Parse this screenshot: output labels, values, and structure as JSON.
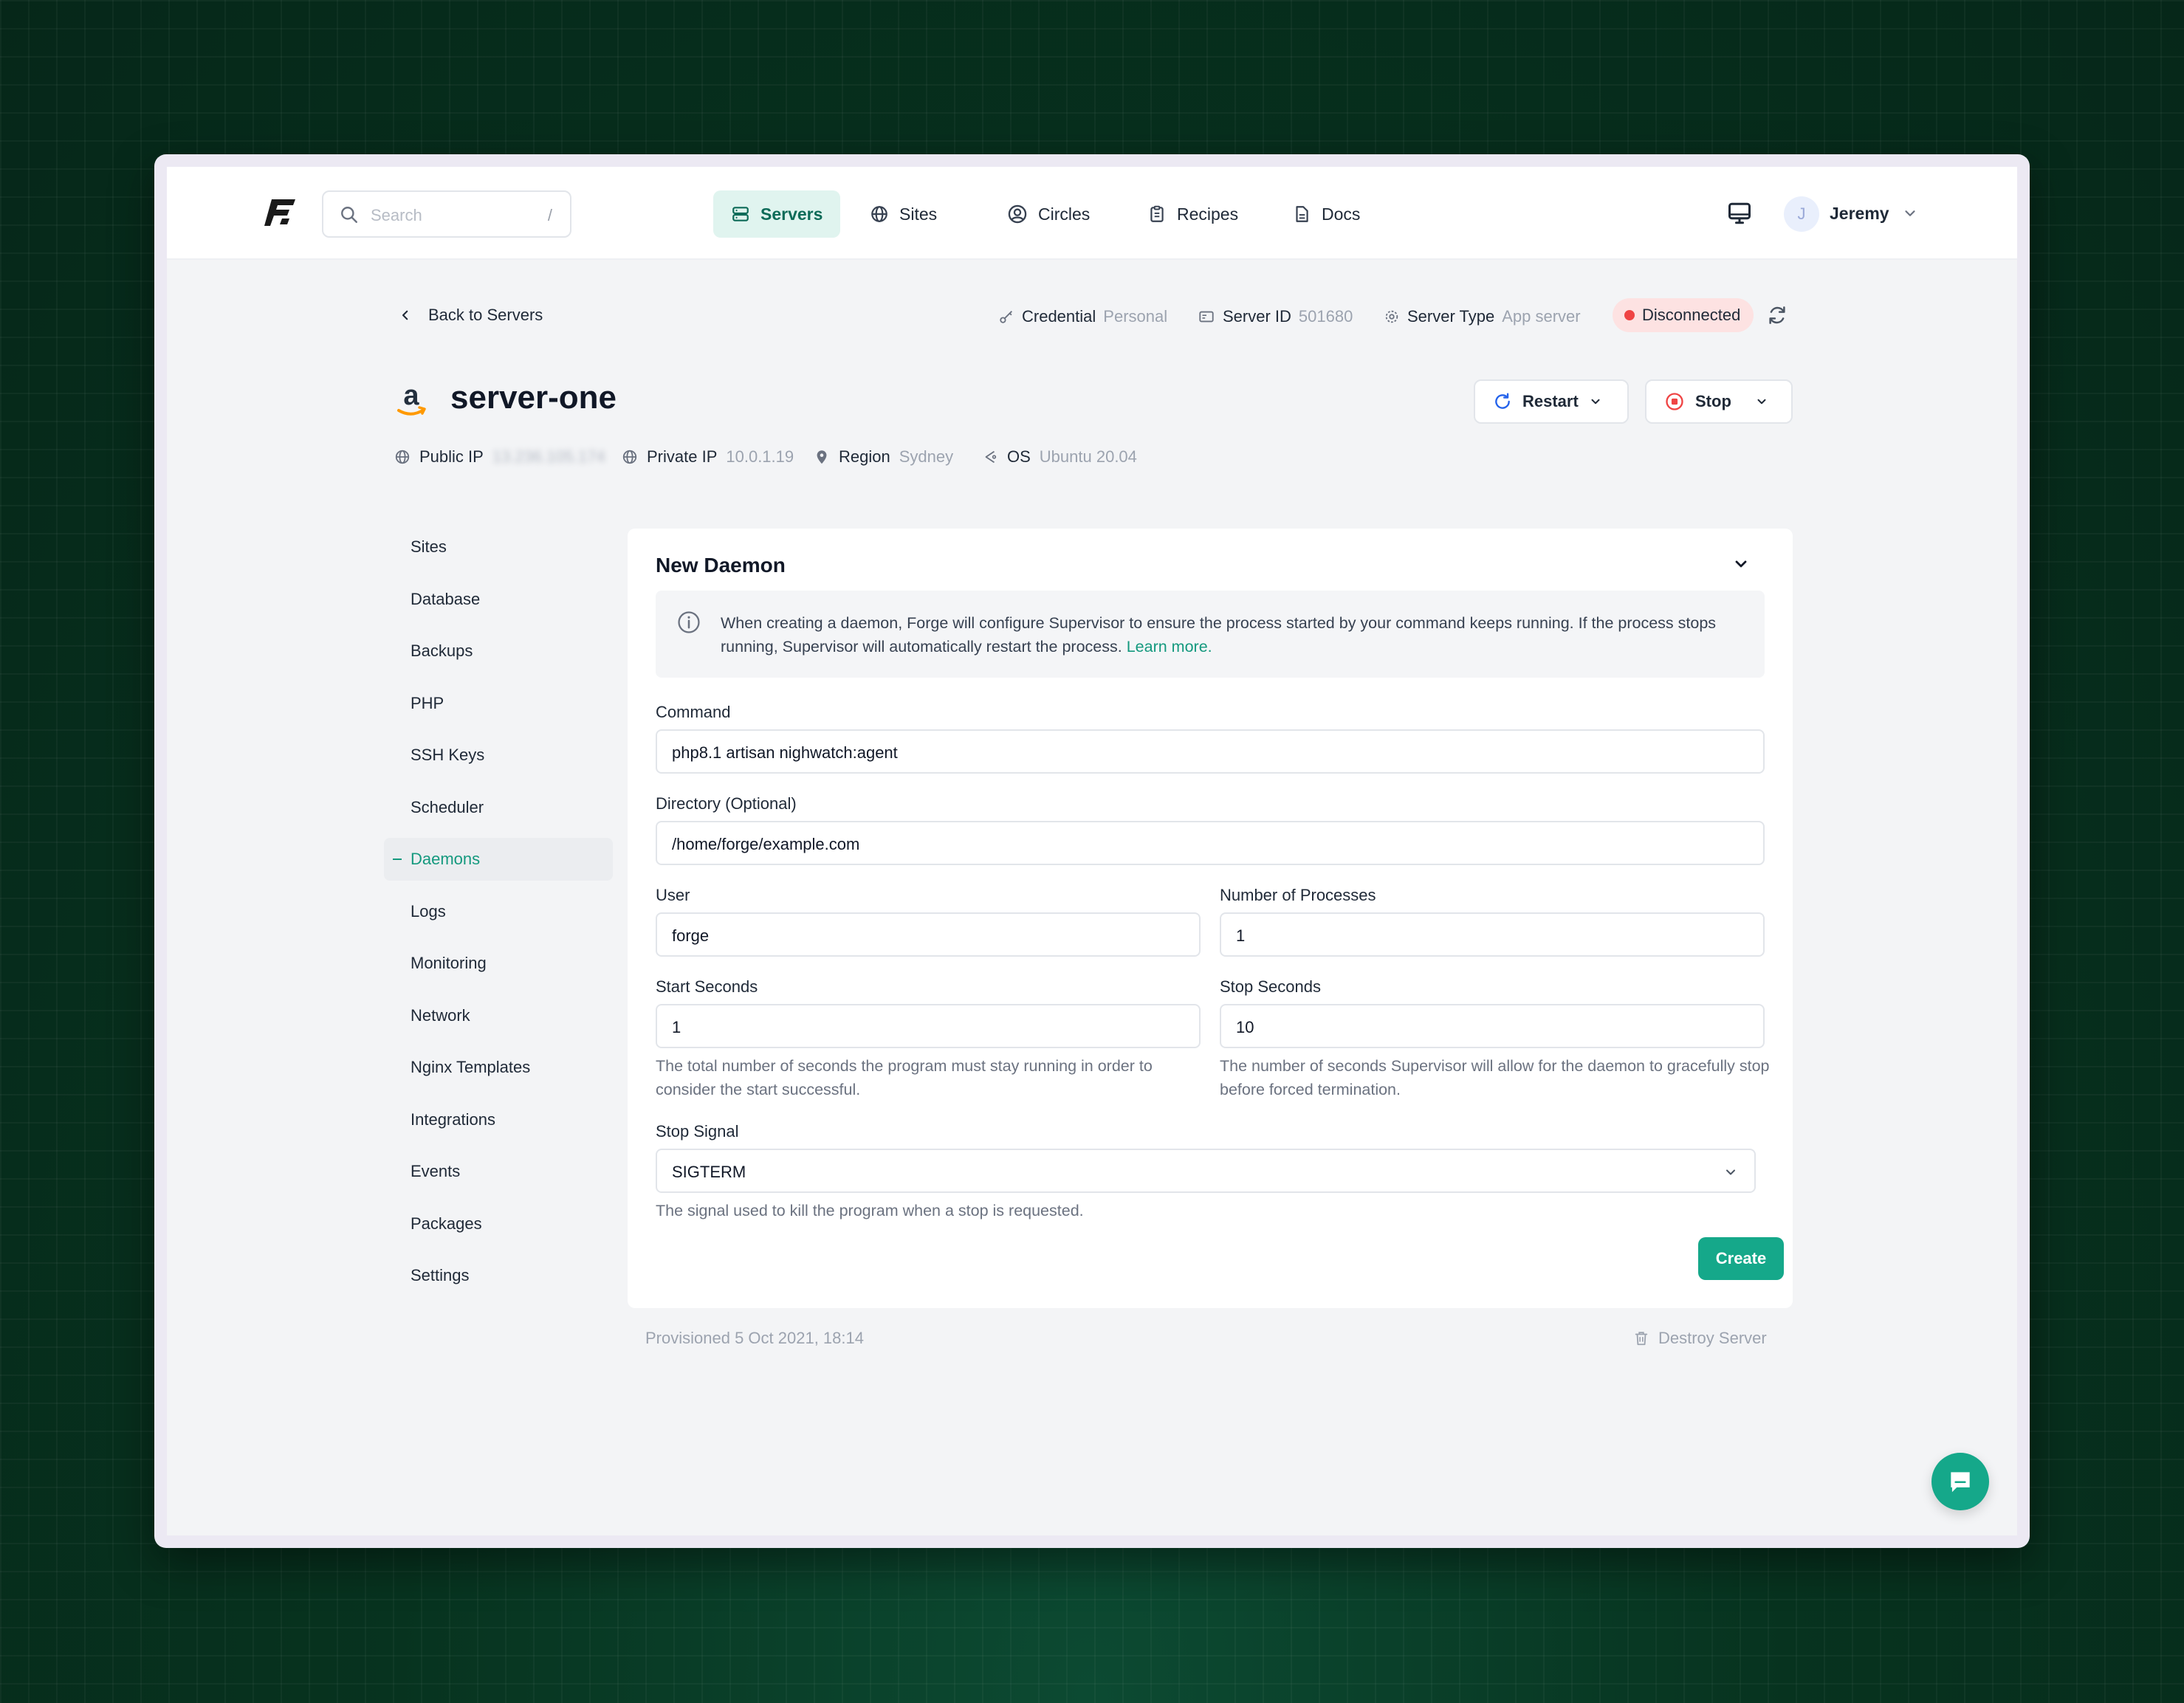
{
  "nav": {
    "search_placeholder": "Search",
    "search_shortcut": "/",
    "items": [
      {
        "label": "Servers",
        "icon": "server-icon",
        "active": true
      },
      {
        "label": "Sites",
        "icon": "globe-icon"
      },
      {
        "label": "Circles",
        "icon": "user-circle-icon"
      },
      {
        "label": "Recipes",
        "icon": "clipboard-icon"
      },
      {
        "label": "Docs",
        "icon": "document-icon"
      }
    ],
    "user_initial": "J",
    "user_name": "Jeremy"
  },
  "header": {
    "back_label": "Back to Servers",
    "credential_label": "Credential",
    "credential_value": "Personal",
    "server_id_label": "Server ID",
    "server_id_value": "501680",
    "server_type_label": "Server Type",
    "server_type_value": "App server",
    "status": "Disconnected",
    "status_color": "#ef4444"
  },
  "server": {
    "name": "server-one",
    "provider_logo": "a",
    "restart_label": "Restart",
    "stop_label": "Stop",
    "public_ip_label": "Public IP",
    "public_ip_value": "13.236.105.174",
    "private_ip_label": "Private IP",
    "private_ip_value": "10.0.1.19",
    "region_label": "Region",
    "region_value": "Sydney",
    "os_label": "OS",
    "os_value": "Ubuntu 20.04"
  },
  "sidebar": {
    "items": [
      {
        "label": "Sites"
      },
      {
        "label": "Database"
      },
      {
        "label": "Backups"
      },
      {
        "label": "PHP"
      },
      {
        "label": "SSH Keys"
      },
      {
        "label": "Scheduler"
      },
      {
        "label": "Daemons",
        "active": true
      },
      {
        "label": "Logs"
      },
      {
        "label": "Monitoring"
      },
      {
        "label": "Network"
      },
      {
        "label": "Nginx Templates"
      },
      {
        "label": "Integrations"
      },
      {
        "label": "Events"
      },
      {
        "label": "Packages"
      },
      {
        "label": "Settings"
      }
    ]
  },
  "form": {
    "title": "New Daemon",
    "notice_text": "When creating a daemon, Forge will configure Supervisor to ensure the process started by your command keeps running. If the process stops running, Supervisor will automatically restart the process.",
    "notice_link": "Learn more.",
    "command_label": "Command",
    "command_value": "php8.1 artisan nighwatch:agent",
    "directory_label": "Directory (Optional)",
    "directory_value": "/home/forge/example.com",
    "user_label": "User",
    "user_value": "forge",
    "processes_label": "Number of Processes",
    "processes_value": "1",
    "start_seconds_label": "Start Seconds",
    "start_seconds_value": "1",
    "start_seconds_help": "The total number of seconds the program must stay running in order to consider the start successful.",
    "stop_seconds_label": "Stop Seconds",
    "stop_seconds_value": "10",
    "stop_seconds_help": "The number of seconds Supervisor will allow for the daemon to gracefully stop before forced termination.",
    "stop_signal_label": "Stop Signal",
    "stop_signal_value": "SIGTERM",
    "stop_signal_help": "The signal used to kill the program when a stop is requested.",
    "submit_label": "Create"
  },
  "footer": {
    "provisioned": "Provisioned 5 Oct 2021, 18:14",
    "destroy_label": "Destroy Server"
  },
  "colors": {
    "accent": "#15a88a",
    "accent_text": "#14997e",
    "nav_active_bg": "#e0f4ef",
    "status_bg": "#fde2e2"
  }
}
